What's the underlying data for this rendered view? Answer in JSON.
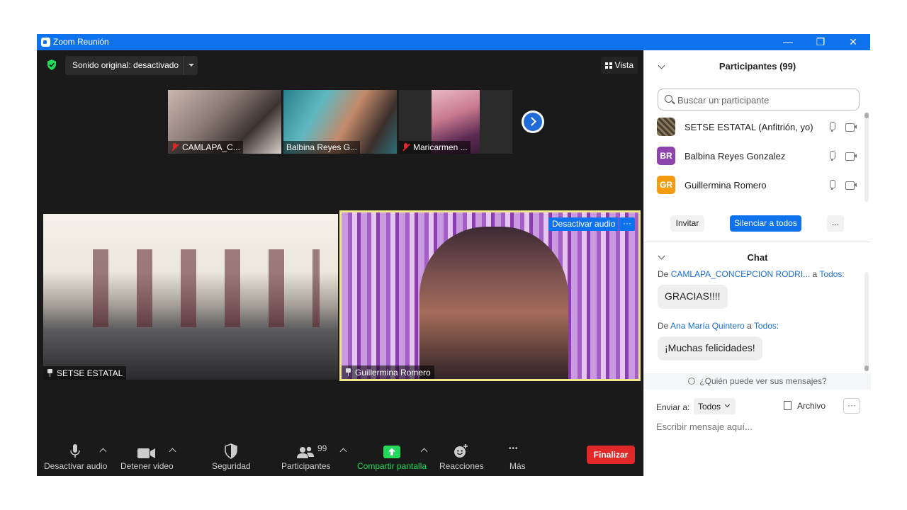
{
  "window": {
    "title": "Zoom Reunión",
    "controls": [
      "—",
      "❐",
      "✕"
    ]
  },
  "meeting": {
    "sound_label": "Sonido original: desactivado",
    "view_label": "Vista",
    "thumbnails": [
      {
        "name": "CAMLAPA_C...",
        "muted": true
      },
      {
        "name": "Balbina Reyes G...",
        "muted": false
      },
      {
        "name": "Maricarmen ...",
        "muted": true
      }
    ],
    "tiles": [
      {
        "name": "SETSE ESTATAL"
      },
      {
        "name": "Guillermina Romero"
      }
    ],
    "speaker_actions": {
      "mute_label": "Desactivar audio",
      "more_label": "···"
    }
  },
  "toolbar": {
    "audio_label": "Desactivar audio",
    "video_label": "Detener video",
    "security_label": "Seguridad",
    "participants_label": "Participantes",
    "participants_count": "99",
    "share_label": "Compartir pantalla",
    "reactions_label": "Reacciones",
    "more_label": "Más",
    "more_dots": "•••",
    "end_label": "Finalizar",
    "share_color": "#23d959",
    "end_color": "#e02828"
  },
  "participants_panel": {
    "title": "Participantes (99)",
    "search_placeholder": "Buscar un participante",
    "list": [
      {
        "initials": "",
        "name": "SETSE ESTATAL (Anfitrión, yo)",
        "avatar_color": "#6b5a3a"
      },
      {
        "initials": "BR",
        "name": "Balbina Reyes Gonzalez",
        "avatar_color": "#8e44ad"
      },
      {
        "initials": "GR",
        "name": "Guillermina Romero",
        "avatar_color": "#f39c12"
      }
    ],
    "invite_label": "Invitar",
    "mute_all_label": "Silenciar a todos",
    "more_label": "..."
  },
  "chat": {
    "title": "Chat",
    "messages": [
      {
        "prefix": "De",
        "from": "CAMLAPA_CONCEPCION RODRI...",
        "to_word": "a",
        "to": "Todos:",
        "text": "GRACIAS!!!!"
      },
      {
        "prefix": "De",
        "from": "Ana María Quintero",
        "to_word": "a",
        "to": "Todos:",
        "text": "¡Muchas felicidades!"
      }
    ],
    "who_can_see": "¿Quién puede ver sus mensajes?",
    "send_to_label": "Enviar a:",
    "send_to_value": "Todos",
    "file_label": "Archivo",
    "more_label": "···",
    "input_placeholder": "Escribir mensaje aquí..."
  }
}
